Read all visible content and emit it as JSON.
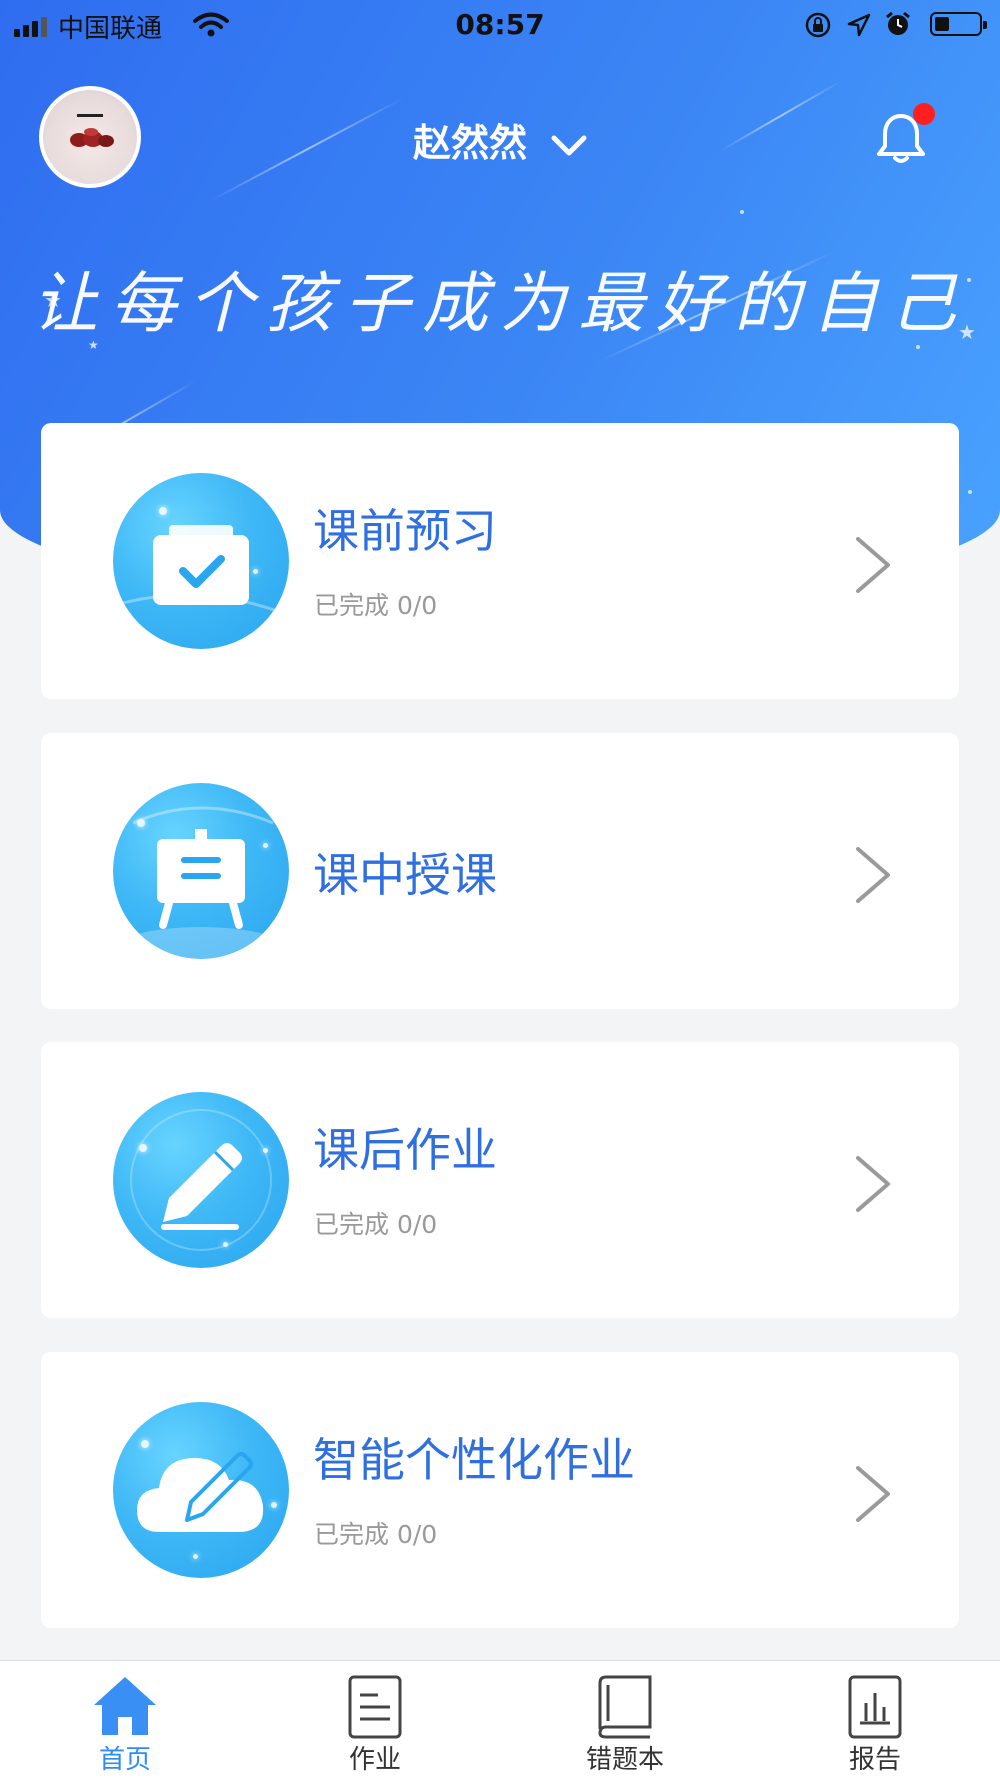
{
  "status_bar": {
    "carrier": "中国联通",
    "time": "08:57"
  },
  "header": {
    "user_name": "赵然然",
    "slogan": "让每个孩子成为最好的自己",
    "notification_badge": true
  },
  "cards": [
    {
      "title": "课前预习",
      "subtitle": "已完成 0/0",
      "icon": "checked-box-icon"
    },
    {
      "title": "课中授课",
      "subtitle": "",
      "icon": "easel-board-icon"
    },
    {
      "title": "课后作业",
      "subtitle": "已完成 0/0",
      "icon": "pencil-icon"
    },
    {
      "title": "智能个性化作业",
      "subtitle": "已完成 0/0",
      "icon": "cloud-pencil-icon"
    }
  ],
  "tabbar": {
    "tabs": [
      {
        "label": "首页",
        "icon": "home-icon",
        "active": true
      },
      {
        "label": "作业",
        "icon": "document-icon",
        "active": false
      },
      {
        "label": "错题本",
        "icon": "book-icon",
        "active": false
      },
      {
        "label": "报告",
        "icon": "bar-chart-icon",
        "active": false
      }
    ]
  },
  "colors": {
    "brand_blue": "#3b86f5",
    "title_blue": "#2f6fe0",
    "active_tab": "#2f8bf5",
    "badge_red": "#ff1f1f"
  }
}
